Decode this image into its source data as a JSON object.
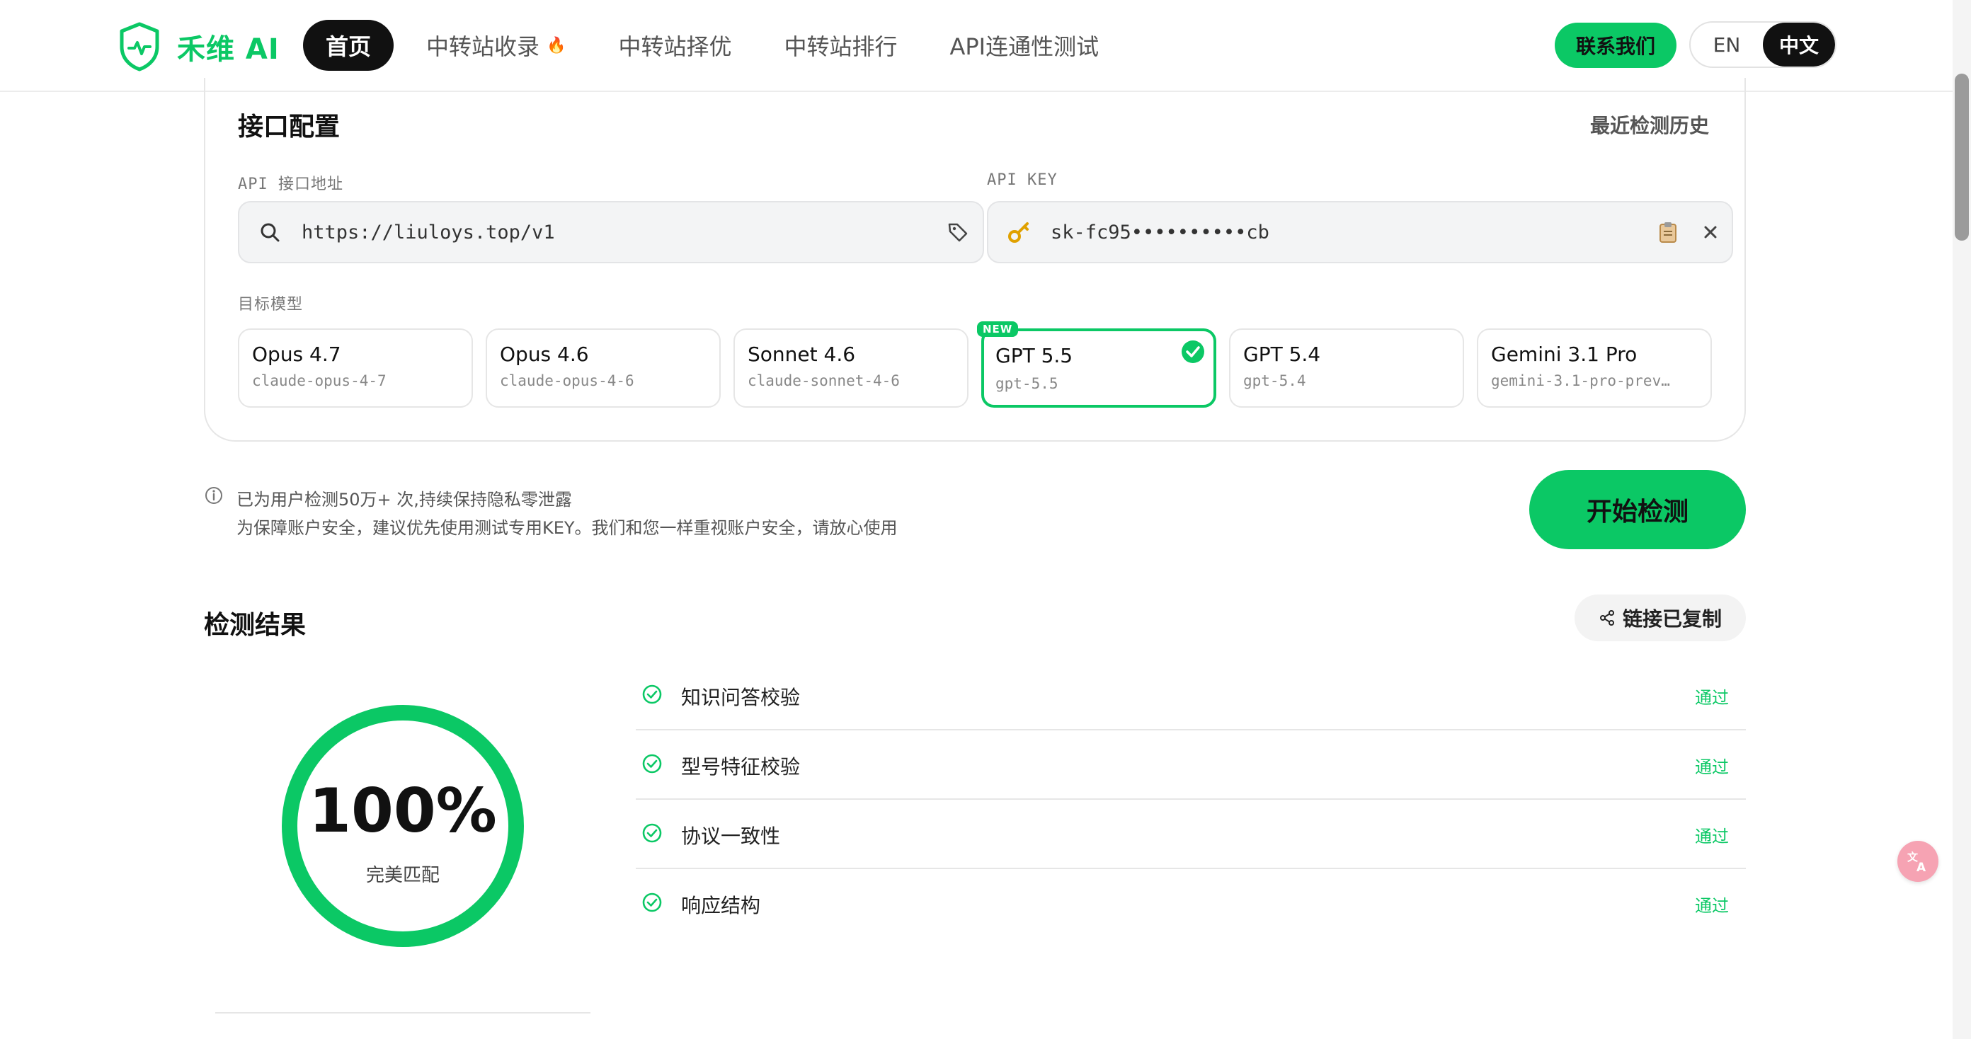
{
  "header": {
    "logo_text": "禾维 AI",
    "nav": [
      {
        "label": "首页",
        "active": true
      },
      {
        "label": "中转站收录",
        "badge_icon": "fire-icon"
      },
      {
        "label": "中转站择优"
      },
      {
        "label": "中转站排行"
      },
      {
        "label": "API连通性测试"
      }
    ],
    "contact_label": "联系我们",
    "lang": {
      "en": "EN",
      "zh": "中文",
      "active": "中文"
    }
  },
  "config": {
    "title": "接口配置",
    "history_link": "最近检测历史",
    "api_url_label": "API 接口地址",
    "api_url_value": "https://liuloys.top/v1",
    "api_key_label": "API KEY",
    "api_key_value": "sk-fc95••••••••••cb",
    "target_model_label": "目标模型",
    "models": [
      {
        "name": "Opus 4.7",
        "id": "claude-opus-4-7"
      },
      {
        "name": "Opus 4.6",
        "id": "claude-opus-4-6"
      },
      {
        "name": "Sonnet 4.6",
        "id": "claude-sonnet-4-6"
      },
      {
        "name": "GPT 5.5",
        "id": "gpt-5.5",
        "badge": "NEW",
        "selected": true
      },
      {
        "name": "GPT 5.4",
        "id": "gpt-5.4"
      },
      {
        "name": "Gemini 3.1 Pro",
        "id": "gemini-3.1-pro-prev…"
      }
    ]
  },
  "info": {
    "line1": "已为用户检测50万+ 次,持续保持隐私零泄露",
    "line2": "为保障账户安全，建议优先使用测试专用KEY。我们和您一样重视账户安全，请放心使用"
  },
  "start_button": "开始检测",
  "results": {
    "title": "检测结果",
    "share_label": "链接已复制",
    "score": "100%",
    "score_fraction": 1.0,
    "score_caption": "完美匹配",
    "checks": [
      {
        "label": "知识问答校验",
        "status": "通过"
      },
      {
        "label": "型号特征校验",
        "status": "通过"
      },
      {
        "label": "协议一致性",
        "status": "通过"
      },
      {
        "label": "响应结构",
        "status": "通过"
      }
    ]
  },
  "colors": {
    "accent": "#0bc865",
    "dark": "#111111",
    "muted": "#888888"
  }
}
